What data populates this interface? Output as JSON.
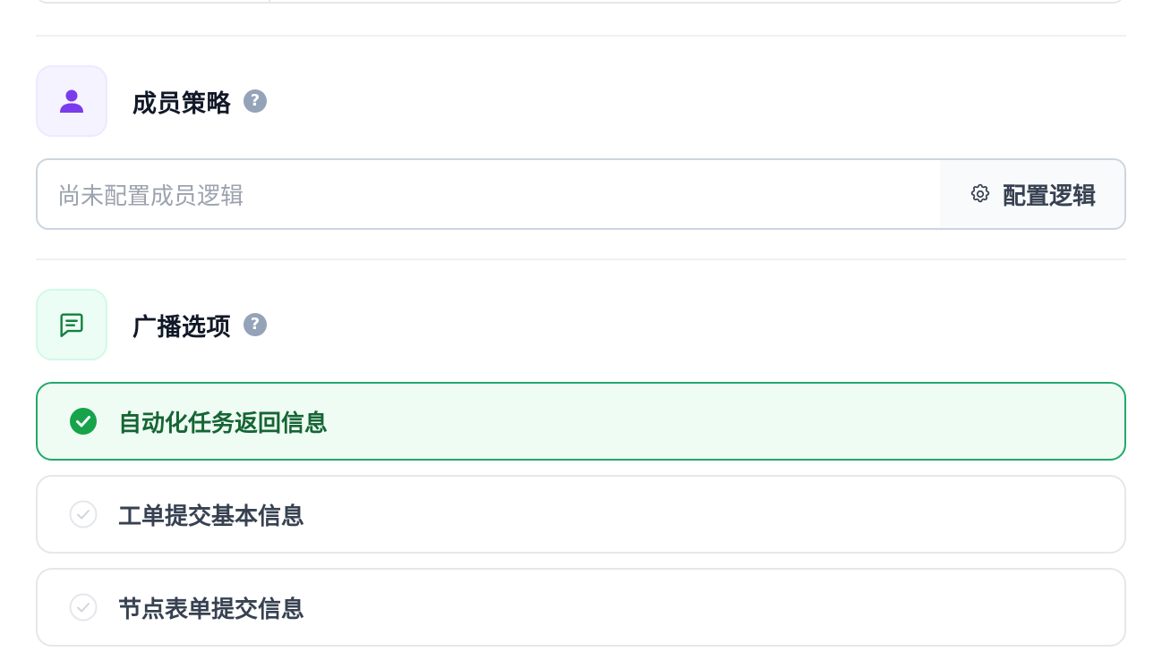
{
  "member_strategy": {
    "title": "成员策略",
    "icon": "user-icon",
    "help_icon": "?",
    "logic_placeholder": "尚未配置成员逻辑",
    "config_button_label": "配置逻辑",
    "config_button_icon": "gear-icon"
  },
  "broadcast": {
    "title": "广播选项",
    "icon": "message-square-icon",
    "help_icon": "?",
    "options": [
      {
        "label": "自动化任务返回信息",
        "checked": true
      },
      {
        "label": "工单提交基本信息",
        "checked": false
      },
      {
        "label": "节点表单提交信息",
        "checked": false
      }
    ]
  },
  "colors": {
    "member_accent": "#7c3aed",
    "broadcast_accent": "#16a34a",
    "checked_border": "#22a86b",
    "checked_bg": "#effcf4"
  }
}
